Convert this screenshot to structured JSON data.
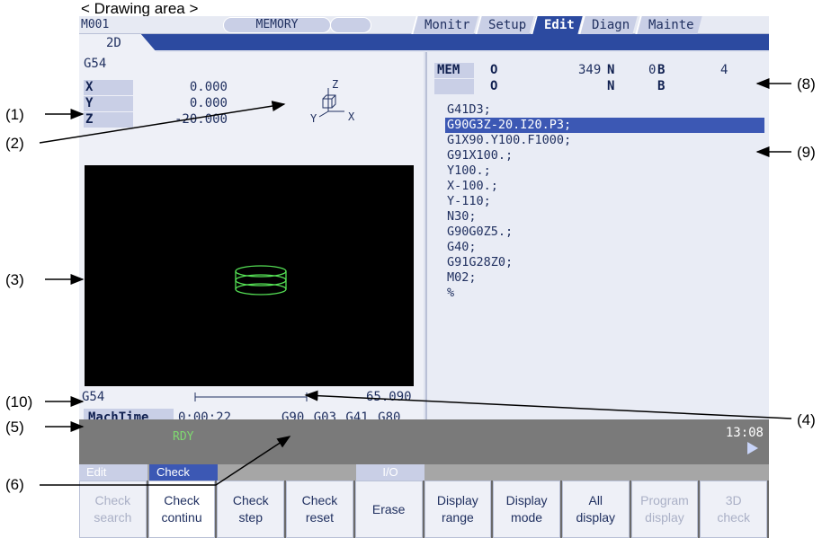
{
  "caption": "< Drawing area >",
  "annotations": [
    "(1)",
    "(2)",
    "(3)",
    "(4)",
    "(5)",
    "(6)",
    "(8)",
    "(9)",
    "(10)"
  ],
  "topbar": {
    "mode_code": "M001",
    "memory_label": "MEMORY",
    "tabs": [
      "Monitr",
      "Setup",
      "Edit",
      "Diagn",
      "Mainte"
    ],
    "active_tab": "Edit"
  },
  "subtab": "2D",
  "left": {
    "coord_system": "G54",
    "axes": [
      {
        "label": "X",
        "value": "0.000"
      },
      {
        "label": "Y",
        "value": "0.000"
      },
      {
        "label": "Z",
        "value": "-20.000"
      }
    ],
    "triad_labels": {
      "z": "Z",
      "y": "Y",
      "x": "X"
    },
    "bottom_coord": "G54",
    "scale_value": "65.090",
    "mach_label": "MachTime",
    "mach_time": "0:00:22",
    "modal_gcodes": "G90 G03 G41 G80"
  },
  "right": {
    "mem_label": "MEM",
    "row1": {
      "o_label": "O",
      "o_value": "349",
      "n_label": "N",
      "n_value": "0",
      "b_label": "B",
      "b_value": "4"
    },
    "row2": {
      "o_label": "O",
      "n_label": "N",
      "b_label": "B"
    },
    "program_lines": [
      "G41D3;",
      "G90G3Z-20.I20.P3;",
      "G1X90.Y100.F1000;",
      "G91X100.;",
      "Y100.;",
      "X-100.;",
      "Y-110;",
      "N30;",
      "G90G0Z5.;",
      "G40;",
      "G91G28Z0;",
      "M02;",
      "%"
    ],
    "highlighted_index": 1
  },
  "status": {
    "ready": "RDY",
    "clock": "13:08"
  },
  "menu_tabs": {
    "edit": "Edit",
    "check": "Check",
    "io": "I/O"
  },
  "softkeys": [
    {
      "label": "Check\nsearch",
      "state": "dim"
    },
    {
      "label": "Check\ncontinu",
      "state": "on"
    },
    {
      "label": "Check\nstep",
      "state": "normal"
    },
    {
      "label": "Check\nreset",
      "state": "normal"
    },
    {
      "label": "Erase",
      "state": "normal"
    },
    {
      "label": "Display\nrange",
      "state": "normal"
    },
    {
      "label": "Display\nmode",
      "state": "normal"
    },
    {
      "label": "All\ndisplay",
      "state": "normal"
    },
    {
      "label": "Program\ndisplay",
      "state": "dim"
    },
    {
      "label": "3D\ncheck",
      "state": "dim"
    }
  ],
  "colors": {
    "accent": "#2c4aa0",
    "highlight": "#3c58b4",
    "toolpath": "#55e055",
    "ready": "#7fd870"
  }
}
